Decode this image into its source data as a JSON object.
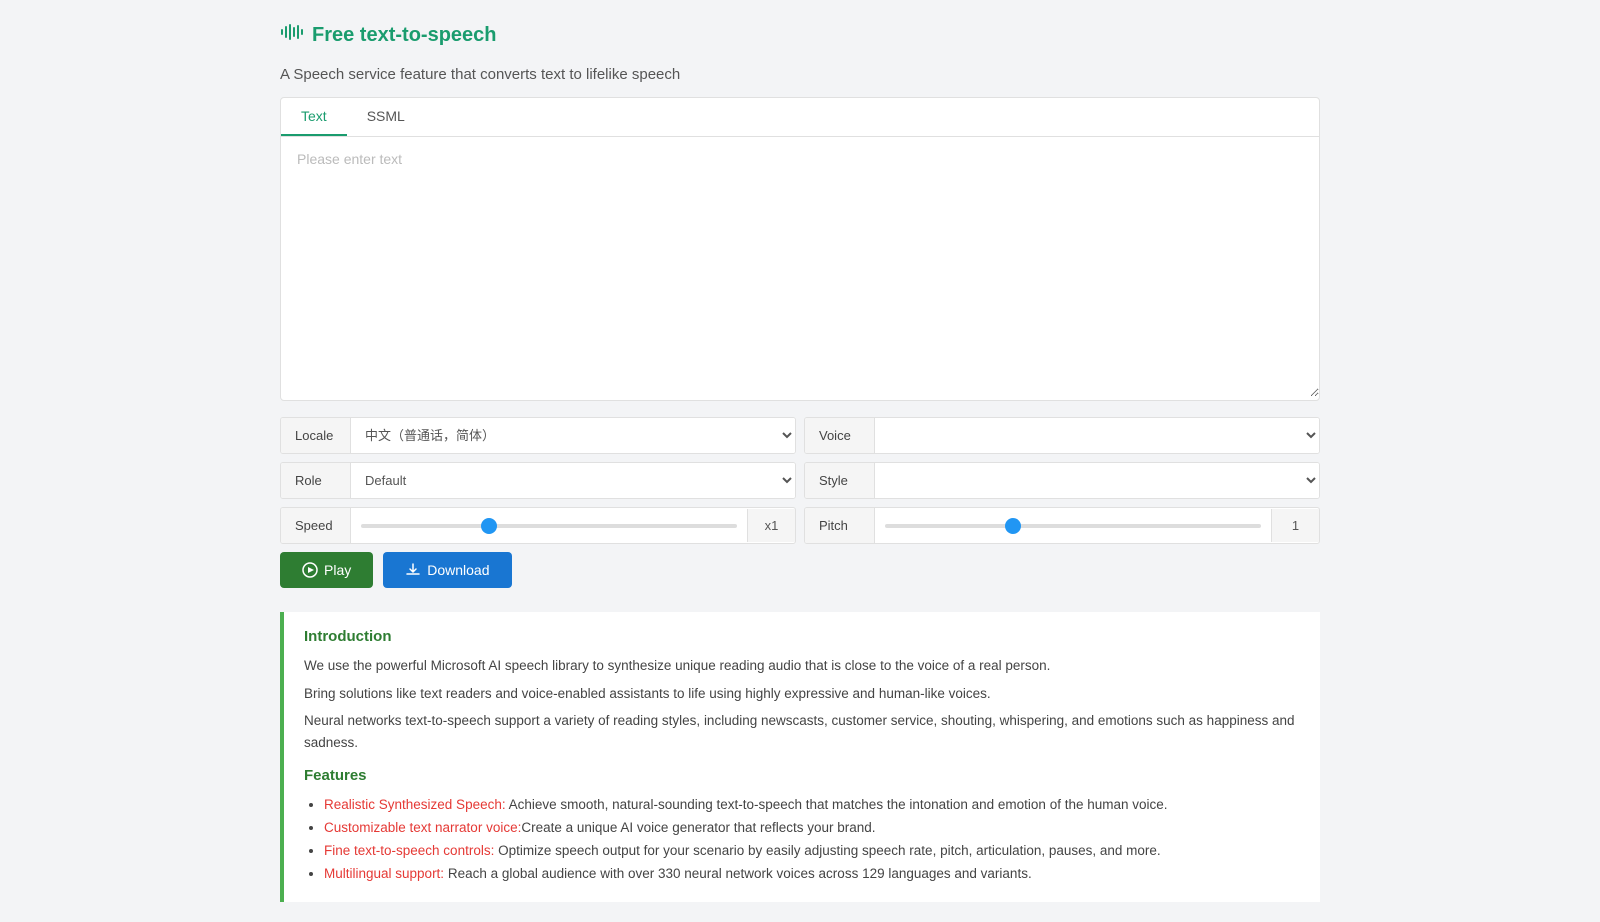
{
  "app": {
    "title": "Free text-to-speech",
    "subtitle": "A Speech service feature that converts text to lifelike speech"
  },
  "tabs": [
    {
      "id": "text",
      "label": "Text",
      "active": true
    },
    {
      "id": "ssml",
      "label": "SSML",
      "active": false
    }
  ],
  "textarea": {
    "placeholder": "Please enter text",
    "value": ""
  },
  "controls": {
    "locale": {
      "label": "Locale",
      "value": "中文（普通话，简体）"
    },
    "voice": {
      "label": "Voice",
      "value": ""
    },
    "role": {
      "label": "Role",
      "placeholder": "Default",
      "value": ""
    },
    "style": {
      "label": "Style",
      "value": ""
    },
    "speed": {
      "label": "Speed",
      "value": 1,
      "min": 0.5,
      "max": 2,
      "step": 0.1,
      "display": "x1"
    },
    "pitch": {
      "label": "Pitch",
      "value": 1,
      "min": 0.5,
      "max": 2,
      "step": 0.1,
      "display": "1"
    }
  },
  "buttons": {
    "play": "Play",
    "download": "Download"
  },
  "intro": {
    "title": "Introduction",
    "lines": [
      "We use the powerful Microsoft AI speech library to synthesize unique reading audio that is close to the voice of a real person.",
      "Bring solutions like text readers and voice-enabled assistants to life using highly expressive and human-like voices.",
      "Neural networks text-to-speech support a variety of reading styles, including newscasts, customer service, shouting, whispering, and emotions such as happiness and sadness."
    ]
  },
  "features": {
    "title": "Features",
    "items": [
      {
        "highlight": "Realistic Synthesized Speech:",
        "text": " Achieve smooth, natural-sounding text-to-speech that matches the intonation and emotion of the human voice."
      },
      {
        "highlight": "Customizable text narrator voice:",
        "text": "Create a unique AI voice generator that reflects your brand."
      },
      {
        "highlight": "Fine text-to-speech controls:",
        "text": " Optimize speech output for your scenario by easily adjusting speech rate, pitch, articulation, pauses, and more."
      },
      {
        "highlight": "Multilingual support:",
        "text": " Reach a global audience with over 330 neural network voices across 129 languages and variants."
      }
    ]
  }
}
